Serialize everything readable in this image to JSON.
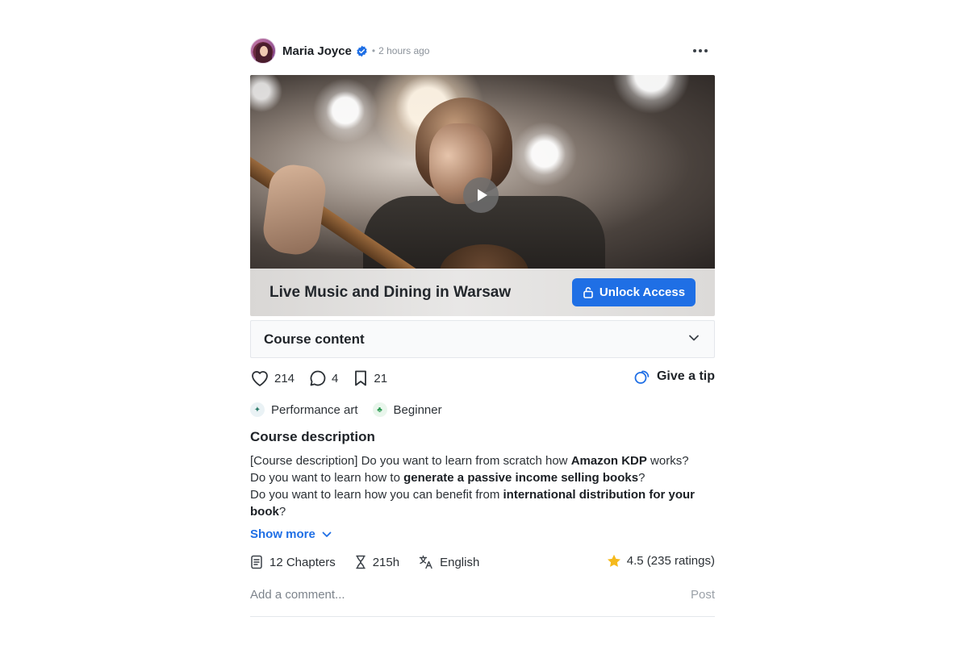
{
  "post": {
    "author": "Maria Joyce",
    "separator": "•",
    "time": "2 hours ago",
    "media_title": "Live Music and Dining in Warsaw",
    "unlock_label": "Unlock Access",
    "course_content_label": "Course content",
    "likes": "214",
    "comments": "4",
    "bookmarks": "21",
    "tip_label": "Give a tip",
    "tags": [
      {
        "label": "Performance art",
        "icon": "performance-art-icon"
      },
      {
        "label": "Beginner",
        "icon": "beginner-icon"
      }
    ],
    "description_title": "Course description",
    "description": {
      "l1_a": "[Course description] Do you want to learn from scratch how ",
      "l1_b": "Amazon KDP",
      "l1_c": " works?",
      "l2_a": "Do you want to learn how to ",
      "l2_b": "generate a passive income selling books",
      "l2_c": "?",
      "l3_a": "Do you want to learn how you can benefit from ",
      "l3_b": "international distribution for your book",
      "l3_c": "?"
    },
    "show_more_label": "Show more",
    "meta": {
      "chapters": "12 Chapters",
      "duration": "215h",
      "language": "English",
      "rating": "4.5 (235 ratings)"
    },
    "comment_placeholder": "Add a comment...",
    "post_label": "Post"
  },
  "colors": {
    "accent": "#1f6fe5",
    "verified": "#1f6fe5",
    "star": "#f5b91c"
  }
}
